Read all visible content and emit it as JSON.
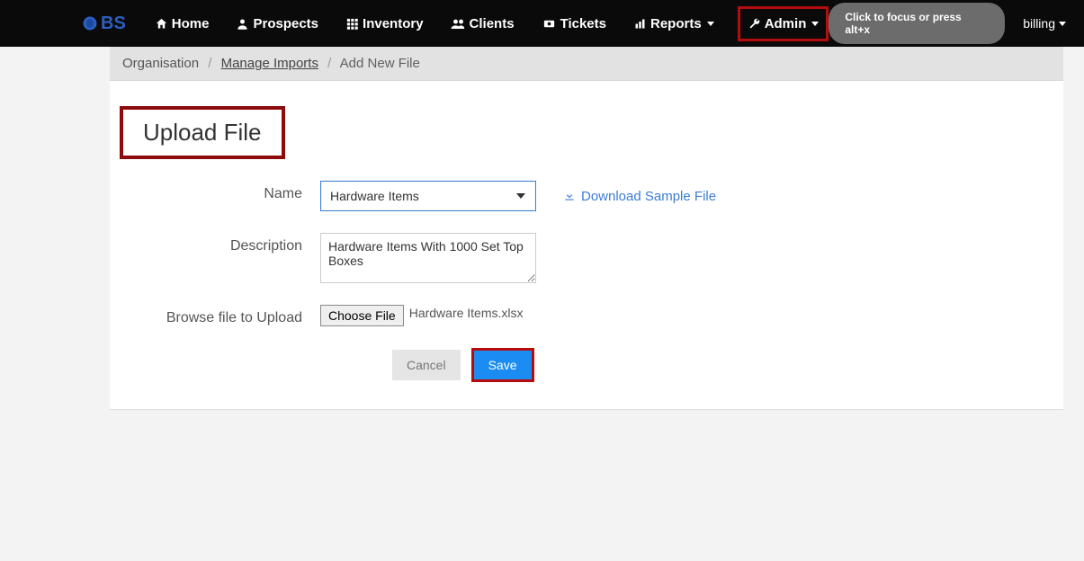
{
  "logo": "BS",
  "nav": {
    "home": "Home",
    "prospects": "Prospects",
    "inventory": "Inventory",
    "clients": "Clients",
    "tickets": "Tickets",
    "reports": "Reports",
    "admin": "Admin"
  },
  "search_pill": "Click to focus or press alt+x",
  "user_menu": "billing",
  "breadcrumb": {
    "org": "Organisation",
    "manage": "Manage Imports",
    "current": "Add New File"
  },
  "page_title": "Upload File",
  "form": {
    "name_label": "Name",
    "name_value": "Hardware Items",
    "download_sample": "Download Sample File",
    "description_label": "Description",
    "description_value": "Hardware Items With 1000 Set Top Boxes",
    "browse_label": "Browse file to Upload",
    "choose_file_btn": "Choose File",
    "chosen_file": "Hardware Items.xlsx",
    "cancel": "Cancel",
    "save": "Save"
  }
}
